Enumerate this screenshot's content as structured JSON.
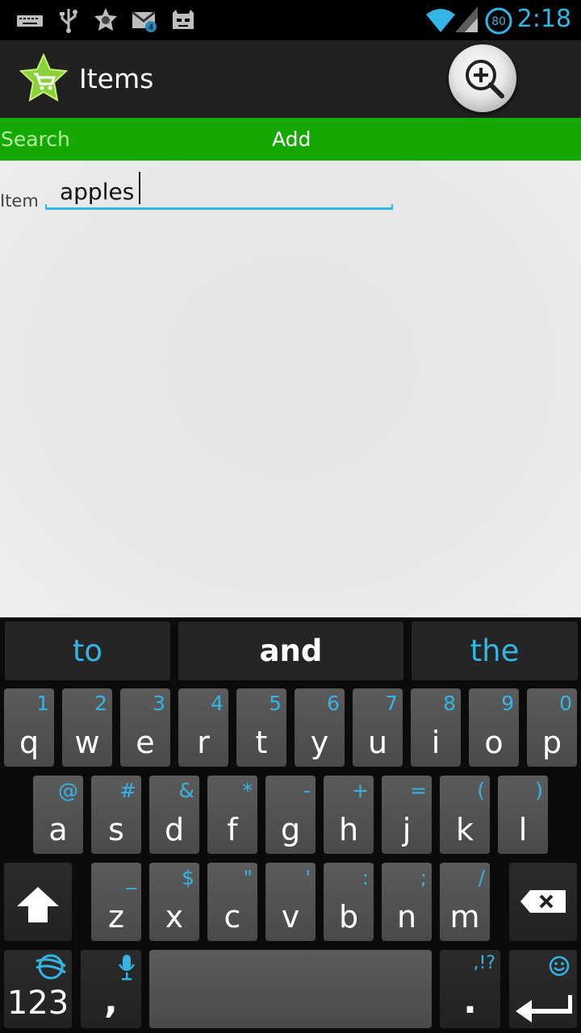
{
  "status_bar": {
    "time": "2:18",
    "battery": "80",
    "notification_icons": [
      "keyboard-icon",
      "usb-icon",
      "star-app-icon",
      "gmail-icon",
      "cyanogen-icon"
    ],
    "gmail_count": "4"
  },
  "action_bar": {
    "title": "Items",
    "search_button_icon": "zoom-in-icon"
  },
  "tabs": {
    "search": "Search",
    "add": "Add"
  },
  "form": {
    "item_label": "Item",
    "item_value": "apples"
  },
  "keyboard": {
    "suggestions": [
      "to",
      "and",
      "the"
    ],
    "row1": [
      {
        "main": "q",
        "alt": "1"
      },
      {
        "main": "w",
        "alt": "2"
      },
      {
        "main": "e",
        "alt": "3"
      },
      {
        "main": "r",
        "alt": "4"
      },
      {
        "main": "t",
        "alt": "5"
      },
      {
        "main": "y",
        "alt": "6"
      },
      {
        "main": "u",
        "alt": "7"
      },
      {
        "main": "i",
        "alt": "8"
      },
      {
        "main": "o",
        "alt": "9"
      },
      {
        "main": "p",
        "alt": "0"
      }
    ],
    "row2": [
      {
        "main": "a",
        "alt": "@"
      },
      {
        "main": "s",
        "alt": "#"
      },
      {
        "main": "d",
        "alt": "&"
      },
      {
        "main": "f",
        "alt": "*"
      },
      {
        "main": "g",
        "alt": "-"
      },
      {
        "main": "h",
        "alt": "+"
      },
      {
        "main": "j",
        "alt": "="
      },
      {
        "main": "k",
        "alt": "("
      },
      {
        "main": "l",
        "alt": ")"
      }
    ],
    "row3": [
      {
        "main": "z",
        "alt": "_"
      },
      {
        "main": "x",
        "alt": "$"
      },
      {
        "main": "c",
        "alt": "\""
      },
      {
        "main": "v",
        "alt": "'"
      },
      {
        "main": "b",
        "alt": ":"
      },
      {
        "main": "n",
        "alt": ";"
      },
      {
        "main": "m",
        "alt": "/"
      }
    ],
    "numbers_key": "123",
    "comma_key": ",",
    "period_key": ".",
    "period_alt": ",!?"
  },
  "colors": {
    "accent": "#33b5e5",
    "tab_green": "#14a800",
    "action_bar": "#212121"
  }
}
